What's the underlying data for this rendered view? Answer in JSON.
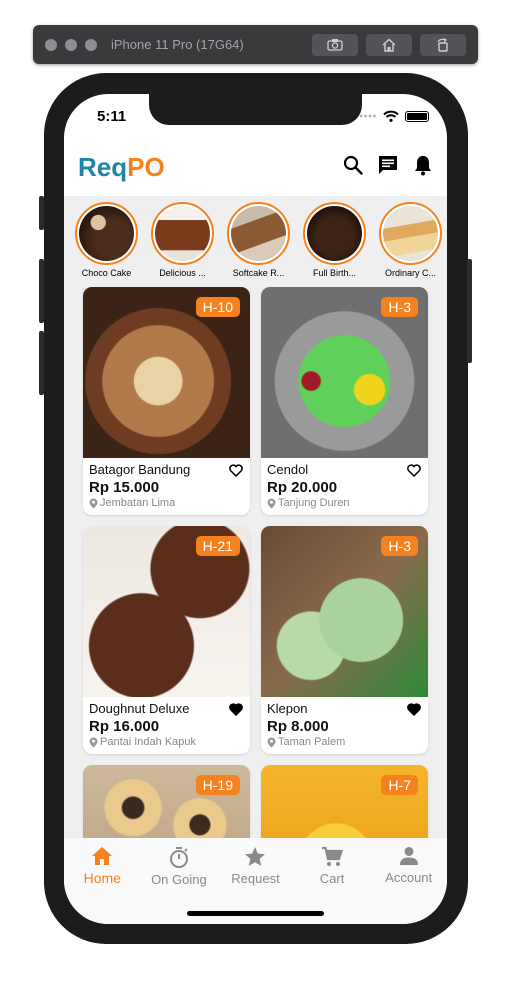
{
  "simulator": {
    "title": "iPhone 11 Pro (17G64)"
  },
  "status_bar": {
    "time": "5:11"
  },
  "app": {
    "logo_part1": "Req",
    "logo_part2": "PO",
    "accent_color": "#f5821f",
    "brand_color": "#1f84a8",
    "header_icons": [
      "search-icon",
      "chat-icon",
      "bell-icon"
    ]
  },
  "categories": [
    {
      "label": "Choco Cake"
    },
    {
      "label": "Delicious ..."
    },
    {
      "label": "Softcake R..."
    },
    {
      "label": "Full Birth..."
    },
    {
      "label": "Ordinary C..."
    }
  ],
  "products": [
    {
      "name": "Batagor Bandung",
      "price": "Rp 15.000",
      "location": "Jembatan Lima",
      "badge": "H-10",
      "favorited": false
    },
    {
      "name": "Cendol",
      "price": "Rp 20.000",
      "location": "Tanjung Duren",
      "badge": "H-3",
      "favorited": false
    },
    {
      "name": "Doughnut Deluxe",
      "price": "Rp 16.000",
      "location": "Pantai Indah Kapuk",
      "badge": "H-21",
      "favorited": true
    },
    {
      "name": "Klepon",
      "price": "Rp 8.000",
      "location": "Taman Palem",
      "badge": "H-3",
      "favorited": true
    },
    {
      "name": "",
      "price": "",
      "location": "",
      "badge": "H-19",
      "favorited": false
    },
    {
      "name": "",
      "price": "",
      "location": "",
      "badge": "H-7",
      "favorited": false
    }
  ],
  "bottom_nav": [
    {
      "label": "Home",
      "icon": "home-icon",
      "active": true
    },
    {
      "label": "On Going",
      "icon": "stopwatch-icon",
      "active": false
    },
    {
      "label": "Request",
      "icon": "star-icon",
      "active": false
    },
    {
      "label": "Cart",
      "icon": "cart-icon",
      "active": false
    },
    {
      "label": "Account",
      "icon": "person-icon",
      "active": false
    }
  ]
}
